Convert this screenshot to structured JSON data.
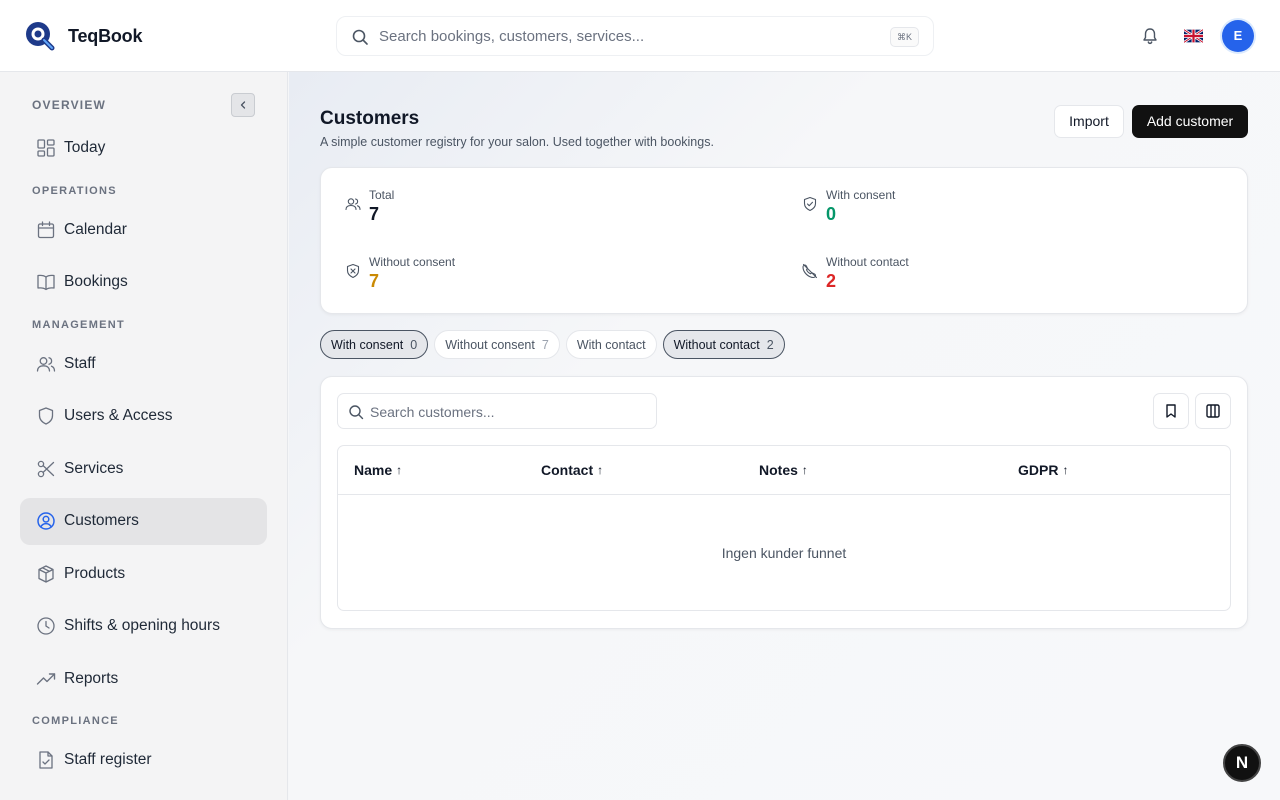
{
  "header": {
    "brand_name": "TeqBook",
    "search_placeholder": "Search bookings, customers, services...",
    "search_shortcut": "⌘K",
    "avatar_initial": "E"
  },
  "sidebar": {
    "sections": {
      "overview": "OVERVIEW",
      "operations": "OPERATIONS",
      "management": "MANAGEMENT",
      "compliance": "COMPLIANCE"
    },
    "items": [
      {
        "label": "Today",
        "icon": "dashboard-icon"
      },
      {
        "label": "Calendar",
        "icon": "calendar-icon"
      },
      {
        "label": "Bookings",
        "icon": "book-icon"
      },
      {
        "label": "Staff",
        "icon": "users-icon"
      },
      {
        "label": "Users & Access",
        "icon": "shield-icon"
      },
      {
        "label": "Services",
        "icon": "scissors-icon"
      },
      {
        "label": "Customers",
        "icon": "user-circle-icon",
        "active": true
      },
      {
        "label": "Products",
        "icon": "package-icon"
      },
      {
        "label": "Shifts & opening hours",
        "icon": "clock-icon"
      },
      {
        "label": "Reports",
        "icon": "trending-up-icon"
      },
      {
        "label": "Staff register",
        "icon": "file-check-icon"
      }
    ]
  },
  "page": {
    "title": "Customers",
    "subtitle": "A simple customer registry for your salon. Used together with bookings.",
    "import_label": "Import",
    "add_label": "Add customer"
  },
  "stats": {
    "total": {
      "label": "Total",
      "value": "7",
      "color": "#111827"
    },
    "with_consent": {
      "label": "With consent",
      "value": "0",
      "color": "#059669"
    },
    "without_consent": {
      "label": "Without consent",
      "value": "7",
      "color": "#ca8a04"
    },
    "without_contact": {
      "label": "Without contact",
      "value": "2",
      "color": "#dc2626"
    }
  },
  "filters": [
    {
      "label": "With consent",
      "count": "0",
      "selected": true
    },
    {
      "label": "Without consent",
      "count": "7",
      "selected": false
    },
    {
      "label": "With contact",
      "count": "",
      "selected": false
    },
    {
      "label": "Without contact",
      "count": "2",
      "selected": true
    }
  ],
  "table": {
    "search_placeholder": "Search customers...",
    "columns": [
      "Name",
      "Contact",
      "Notes",
      "GDPR"
    ],
    "sort_arrow": "↑",
    "empty_text": "Ingen kunder funnet"
  },
  "next_badge": "N",
  "colors": {
    "accent_blue": "#2563eb",
    "consent_green": "#059669",
    "warning_amber": "#ca8a04",
    "danger_red": "#dc2626"
  }
}
